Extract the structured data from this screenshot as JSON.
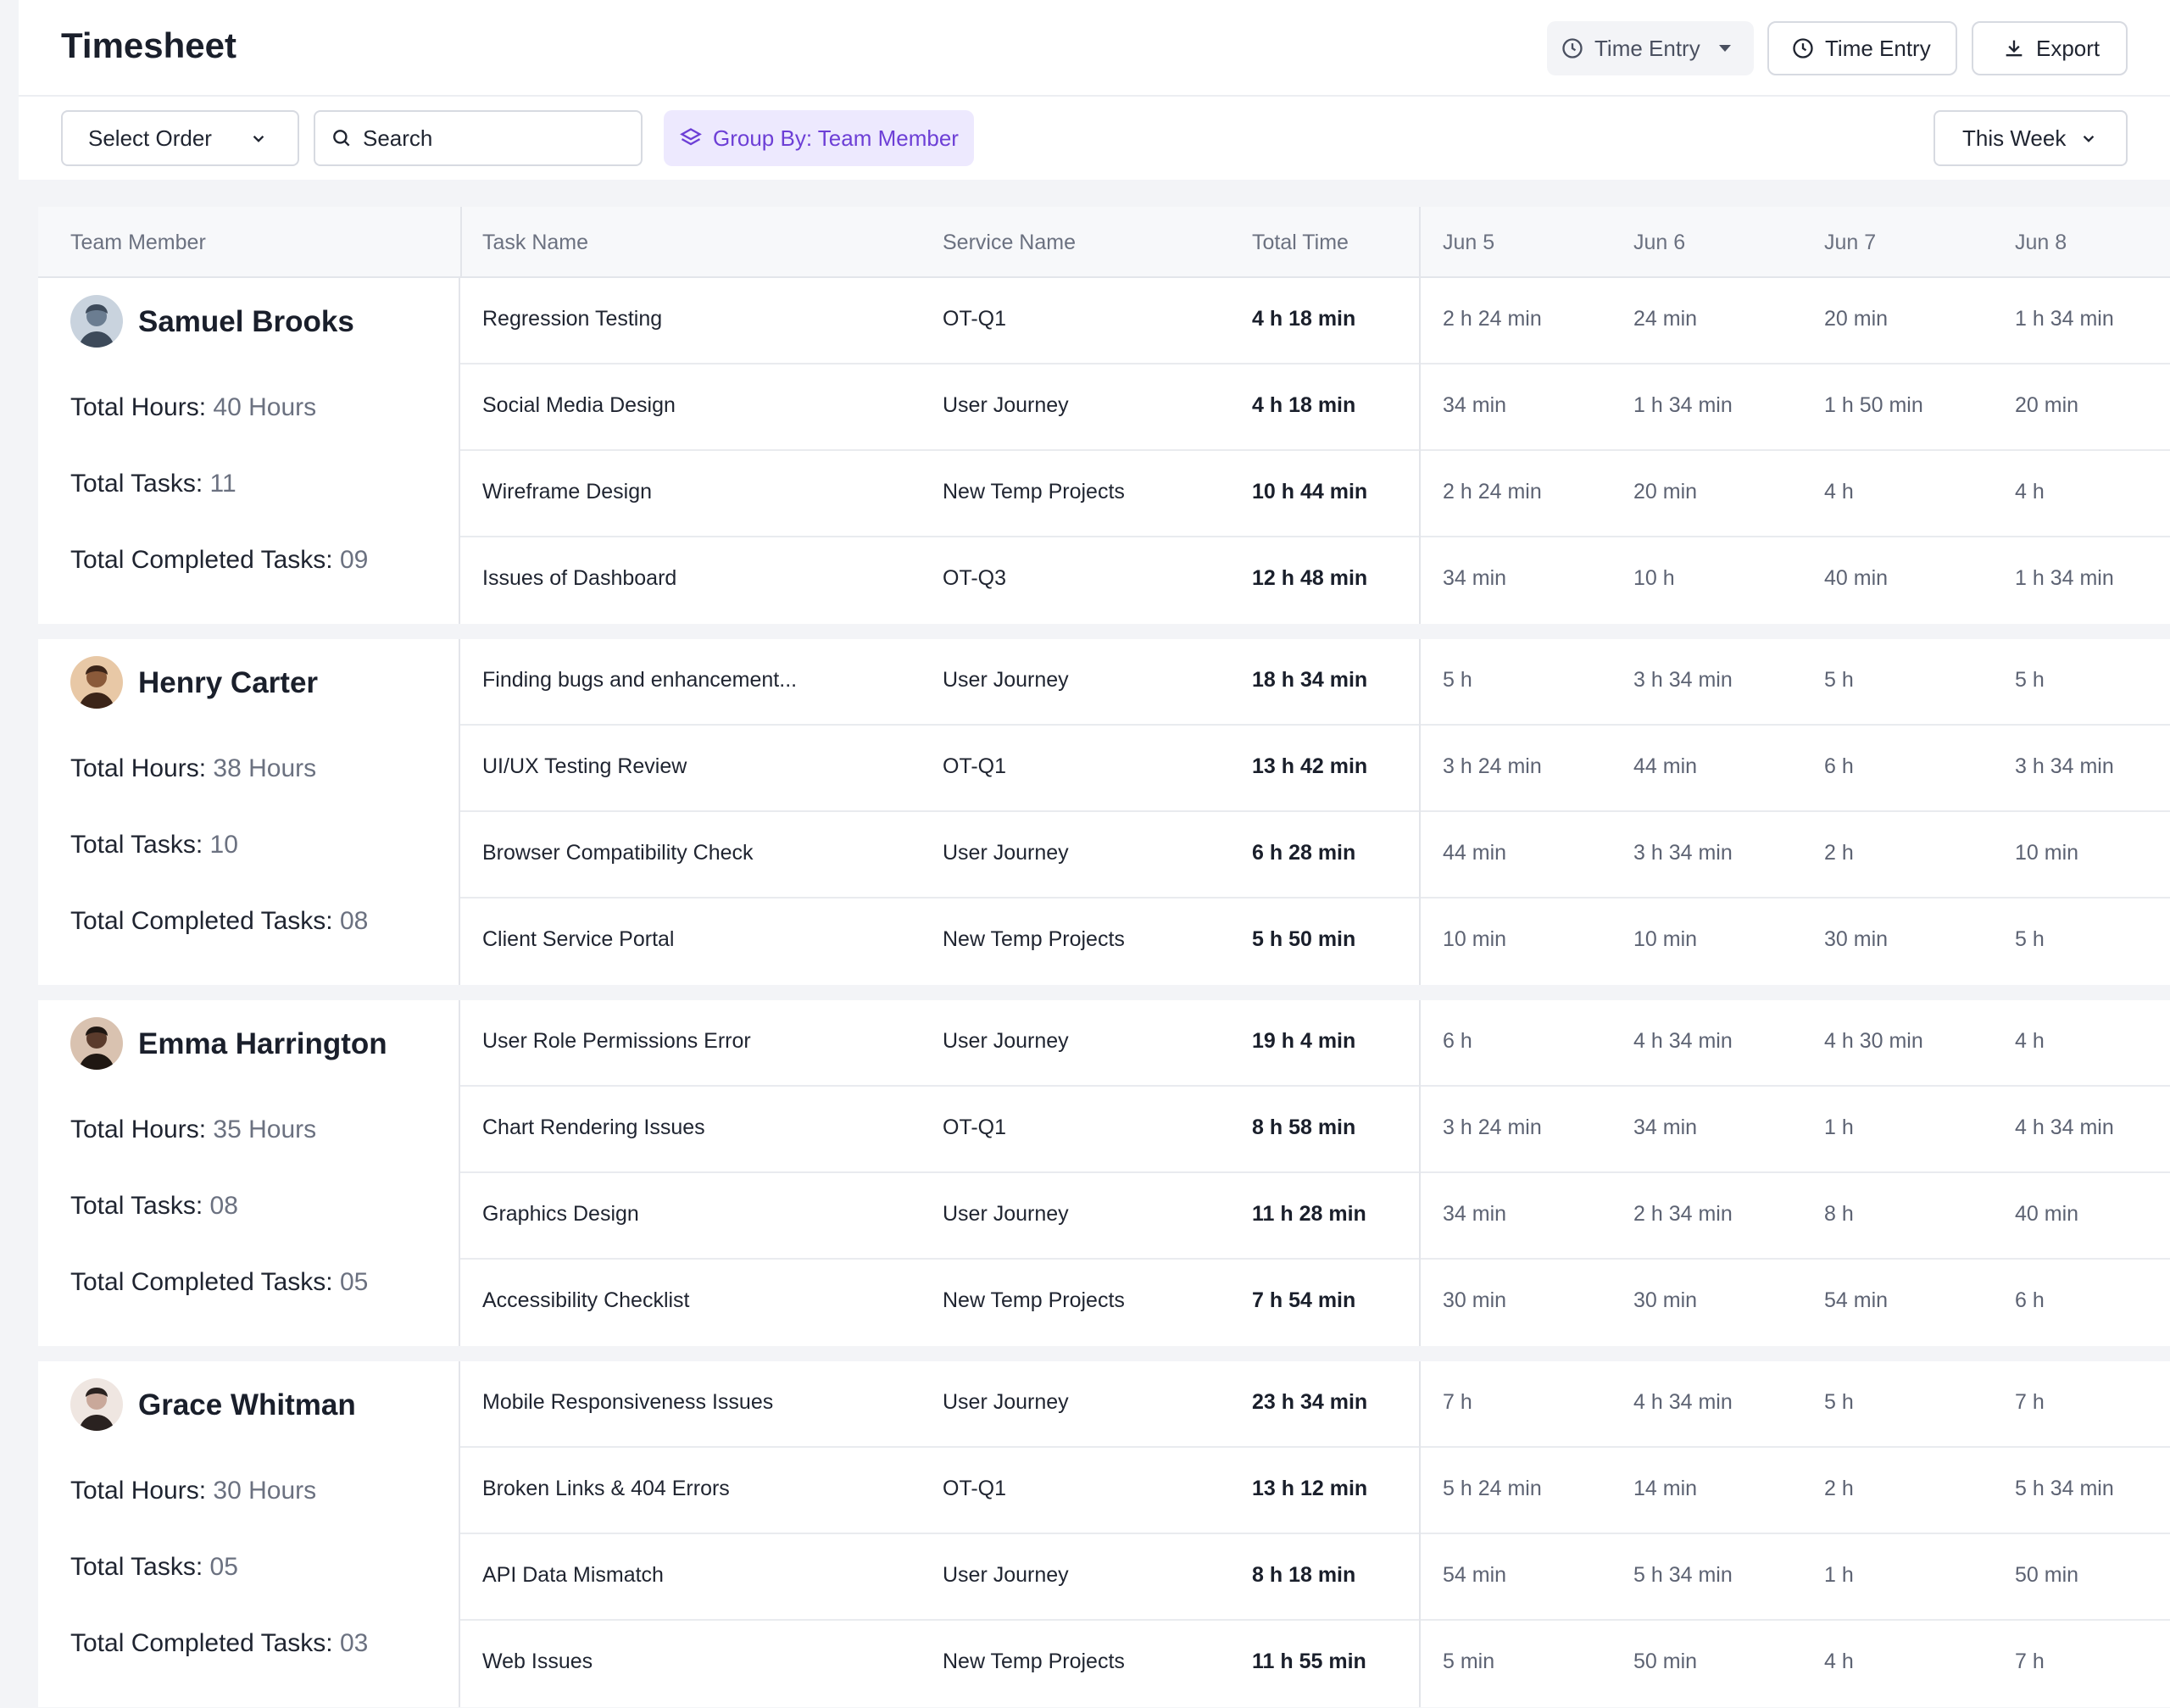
{
  "header": {
    "title": "Timesheet",
    "time_entry_dropdown": "Time Entry",
    "time_entry_button": "Time Entry",
    "export_button": "Export"
  },
  "toolbar": {
    "select_order": "Select Order",
    "search_placeholder": "Search",
    "group_by": "Group By: Team Member",
    "range": "This Week"
  },
  "table": {
    "columns": [
      "Team Member",
      "Task Name",
      "Service Name",
      "Total Time",
      "Jun 5",
      "Jun 6",
      "Jun 7",
      "Jun 8"
    ],
    "stat_labels": {
      "hours": "Total Hours:",
      "tasks": "Total Tasks:",
      "completed": "Total Completed Tasks:"
    },
    "groups": [
      {
        "name": "Samuel Brooks",
        "total_hours": "40 Hours",
        "total_tasks": "11",
        "completed_tasks": "09",
        "rows": [
          {
            "task": "Regression Testing",
            "service": "OT-Q1",
            "total": "4 h 18 min",
            "days": [
              "2 h 24 min",
              "24 min",
              "20 min",
              "1 h 34 min"
            ]
          },
          {
            "task": "Social Media Design",
            "service": "User Journey",
            "total": "4 h 18 min",
            "days": [
              "34 min",
              "1 h 34 min",
              "1 h 50 min",
              "20 min"
            ]
          },
          {
            "task": "Wireframe Design",
            "service": "New Temp Projects",
            "total": "10 h 44 min",
            "days": [
              "2 h 24 min",
              "20 min",
              "4 h",
              "4 h"
            ]
          },
          {
            "task": "Issues of Dashboard",
            "service": "OT-Q3",
            "total": "12 h 48 min",
            "days": [
              "34 min",
              "10 h",
              "40 min",
              "1 h 34 min"
            ]
          }
        ]
      },
      {
        "name": "Henry Carter",
        "total_hours": "38 Hours",
        "total_tasks": "10",
        "completed_tasks": "08",
        "rows": [
          {
            "task": "Finding bugs and enhancement...",
            "service": "User Journey",
            "total": "18 h 34 min",
            "days": [
              "5 h",
              "3 h 34 min",
              "5 h",
              "5 h"
            ]
          },
          {
            "task": "UI/UX Testing Review",
            "service": "OT-Q1",
            "total": "13 h 42 min",
            "days": [
              "3 h 24 min",
              "44 min",
              "6 h",
              "3 h 34 min"
            ]
          },
          {
            "task": "Browser Compatibility Check",
            "service": "User Journey",
            "total": "6 h 28 min",
            "days": [
              "44 min",
              "3 h 34 min",
              "2 h",
              "10 min"
            ]
          },
          {
            "task": "Client Service Portal",
            "service": "New Temp Projects",
            "total": "5 h 50 min",
            "days": [
              "10 min",
              "10 min",
              "30 min",
              "5 h"
            ]
          }
        ]
      },
      {
        "name": "Emma Harrington",
        "total_hours": "35 Hours",
        "total_tasks": "08",
        "completed_tasks": "05",
        "rows": [
          {
            "task": "User Role Permissions Error",
            "service": "User Journey",
            "total": "19 h 4 min",
            "days": [
              "6 h",
              "4 h 34 min",
              "4 h 30 min",
              "4 h"
            ]
          },
          {
            "task": "Chart Rendering Issues",
            "service": "OT-Q1",
            "total": "8 h 58 min",
            "days": [
              "3 h 24 min",
              "34 min",
              "1 h",
              "4 h 34 min"
            ]
          },
          {
            "task": "Graphics Design",
            "service": "User Journey",
            "total": "11 h 28 min",
            "days": [
              "34 min",
              "2 h 34 min",
              "8 h",
              "40 min"
            ]
          },
          {
            "task": "Accessibility Checklist",
            "service": "New Temp Projects",
            "total": "7 h 54 min",
            "days": [
              "30 min",
              "30 min",
              "54 min",
              "6 h"
            ]
          }
        ]
      },
      {
        "name": "Grace Whitman",
        "total_hours": "30 Hours",
        "total_tasks": "05",
        "completed_tasks": "03",
        "rows": [
          {
            "task": "Mobile Responsiveness Issues",
            "service": "User Journey",
            "total": "23 h 34 min",
            "days": [
              "7 h",
              "4 h 34 min",
              "5 h",
              "7 h"
            ]
          },
          {
            "task": "Broken Links & 404 Errors",
            "service": "OT-Q1",
            "total": "13 h 12 min",
            "days": [
              "5 h 24 min",
              "14 min",
              "2 h",
              "5 h 34 min"
            ]
          },
          {
            "task": "API Data Mismatch",
            "service": "User Journey",
            "total": "8 h 18 min",
            "days": [
              "54 min",
              "5 h 34 min",
              "1 h",
              "50 min"
            ]
          },
          {
            "task": "Web Issues",
            "service": "New Temp Projects",
            "total": "11 h 55 min",
            "days": [
              "5 min",
              "50 min",
              "4 h",
              "7 h"
            ]
          }
        ]
      }
    ]
  },
  "colors": {
    "accent": "#6d3fd6",
    "accent_bg": "#ede9fe",
    "border": "#e3e5ea",
    "muted_text": "#6b7180"
  },
  "icons": [
    "clock-icon",
    "chevron-down-icon",
    "download-icon",
    "search-icon",
    "layers-icon",
    "avatar"
  ]
}
